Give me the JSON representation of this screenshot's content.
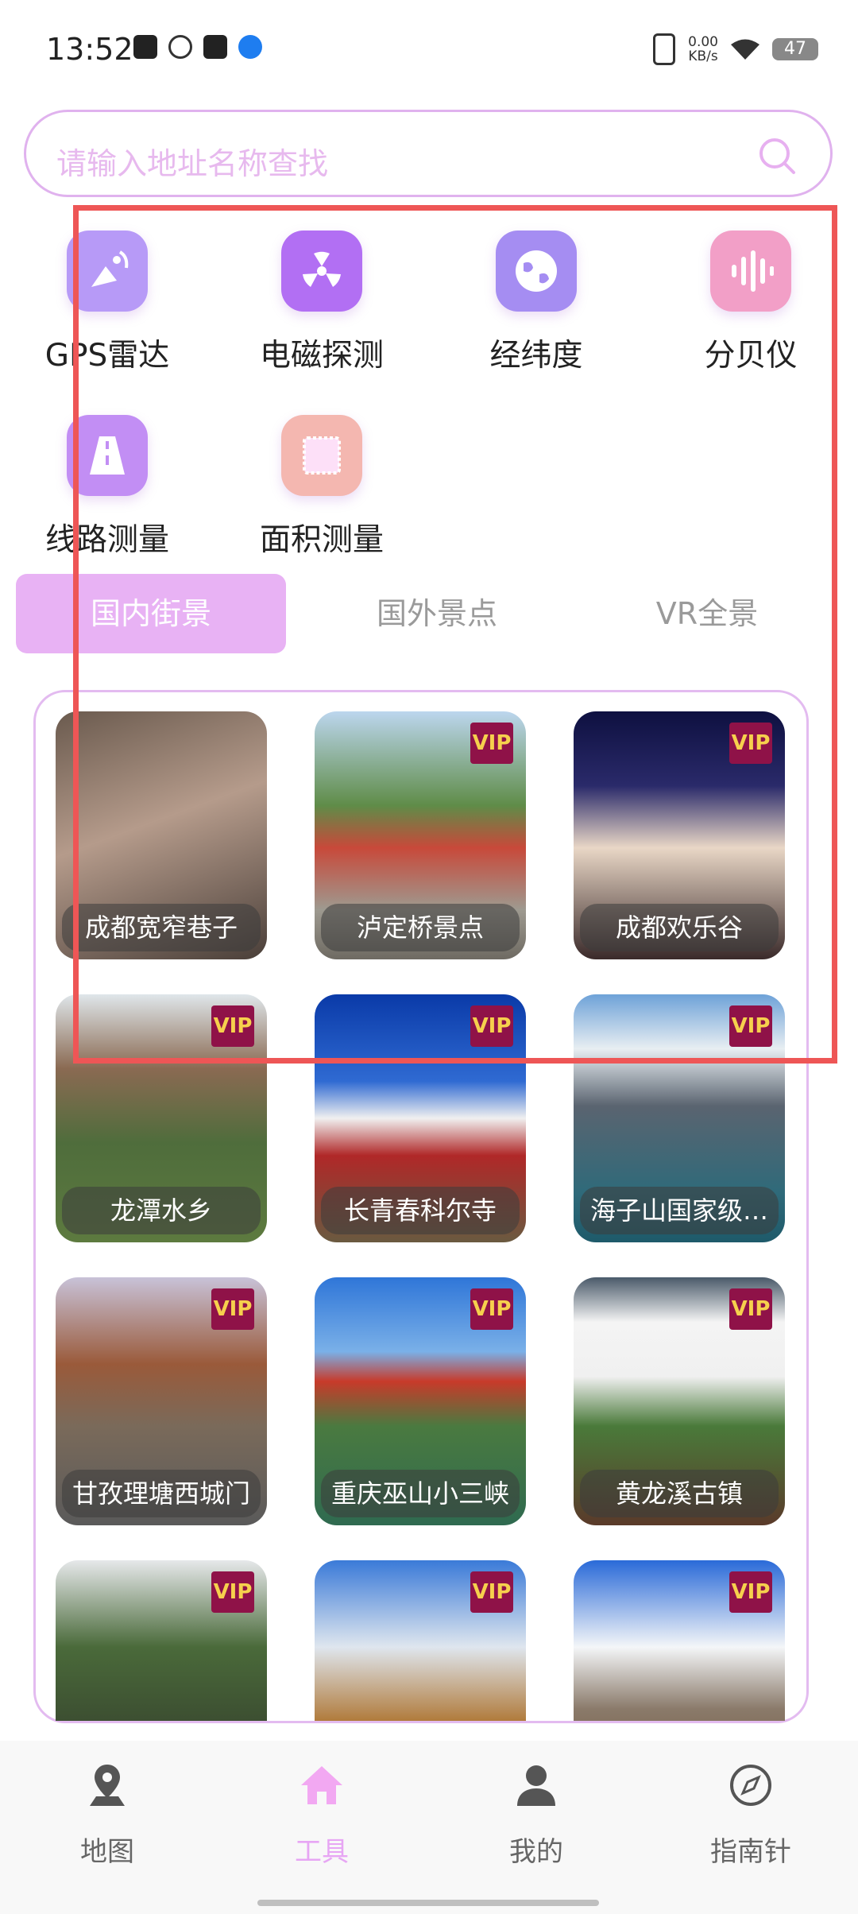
{
  "status_bar": {
    "time": "13:52",
    "net_speed_value": "0.00",
    "net_speed_unit": "KB/s",
    "battery": "47"
  },
  "search": {
    "placeholder": "请输入地址名称查找"
  },
  "tools": [
    {
      "label": "GPS雷达",
      "icon": "satellite-dish-icon",
      "color": "#b79af7"
    },
    {
      "label": "电磁探测",
      "icon": "radiation-icon",
      "color": "#b26ff3"
    },
    {
      "label": "经纬度",
      "icon": "globe-icon",
      "color": "#a58df2"
    },
    {
      "label": "分贝仪",
      "icon": "soundwave-icon",
      "color": "#f29fc7"
    },
    {
      "label": "线路测量",
      "icon": "road-icon",
      "color": "#c28ef4"
    },
    {
      "label": "面积测量",
      "icon": "area-square-icon",
      "color": "#f4b7b0"
    }
  ],
  "tabs": [
    {
      "label": "国内街景",
      "active": true
    },
    {
      "label": "国外景点",
      "active": false
    },
    {
      "label": "VR全景",
      "active": false
    }
  ],
  "vip_label": "VIP",
  "places": [
    {
      "name": "成都宽窄巷子",
      "vip": false
    },
    {
      "name": "泸定桥景点",
      "vip": true
    },
    {
      "name": "成都欢乐谷",
      "vip": true
    },
    {
      "name": "龙潭水乡",
      "vip": true
    },
    {
      "name": "长青春科尔寺",
      "vip": true
    },
    {
      "name": "海子山国家级…",
      "vip": true
    },
    {
      "name": "甘孜理塘西城门",
      "vip": true
    },
    {
      "name": "重庆巫山小三峡",
      "vip": true
    },
    {
      "name": "黄龙溪古镇",
      "vip": true
    },
    {
      "name": "",
      "vip": true
    },
    {
      "name": "",
      "vip": true
    },
    {
      "name": "",
      "vip": true
    }
  ],
  "bottom_nav": [
    {
      "label": "地图",
      "icon": "map-pin-icon",
      "active": false
    },
    {
      "label": "工具",
      "icon": "home-icon",
      "active": true
    },
    {
      "label": "我的",
      "icon": "user-icon",
      "active": false
    },
    {
      "label": "指南针",
      "icon": "compass-icon",
      "active": false
    }
  ],
  "colors": {
    "accent": "#e8b2f4",
    "vip_bg": "#8f1248",
    "vip_text": "#f6d04d",
    "annotation": "#ee5656"
  }
}
